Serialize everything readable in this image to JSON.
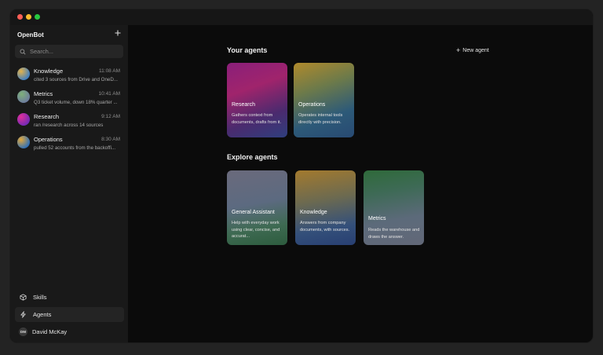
{
  "app": {
    "title": "OpenBot",
    "new_chat_icon": "plus-icon"
  },
  "search": {
    "placeholder": "Search...",
    "value": ""
  },
  "chats": [
    {
      "name": "Knowledge",
      "time": "11:08 AM",
      "preview": "cited 3 sources from Drive and OneD..."
    },
    {
      "name": "Metrics",
      "time": "10:41 AM",
      "preview": "Q3 ticket volume, down 18% quarter ..."
    },
    {
      "name": "Research",
      "time": "9:12 AM",
      "preview": "ran /research across 14 sources"
    },
    {
      "name": "Operations",
      "time": "8:30 AM",
      "preview": "pulled 52 accounts from the backoffi..."
    }
  ],
  "nav": {
    "skills": "Skills",
    "agents": "Agents"
  },
  "user": {
    "initials": "DM",
    "name": "David McKay"
  },
  "main": {
    "your_agents_title": "Your agents",
    "new_agent_label": "New agent",
    "your_agents": [
      {
        "title": "Research",
        "desc": "Gathers context from documents, drafts from it."
      },
      {
        "title": "Operations",
        "desc": "Operates internal tools directly with precision."
      }
    ],
    "explore_title": "Explore agents",
    "explore_agents": [
      {
        "title": "General Assistant",
        "desc": "Help with everyday work using clear, concise, and accurat..."
      },
      {
        "title": "Knowledge",
        "desc": "Answers from company documents, with sources."
      },
      {
        "title": "Metrics",
        "desc": "Reads the warehouse and draws the answer."
      }
    ]
  },
  "colors": {
    "window_bg": "#0b0b0b",
    "sidebar_bg": "#191919",
    "close": "#ff5f57",
    "minimize": "#febc2e",
    "zoom": "#28c840"
  }
}
